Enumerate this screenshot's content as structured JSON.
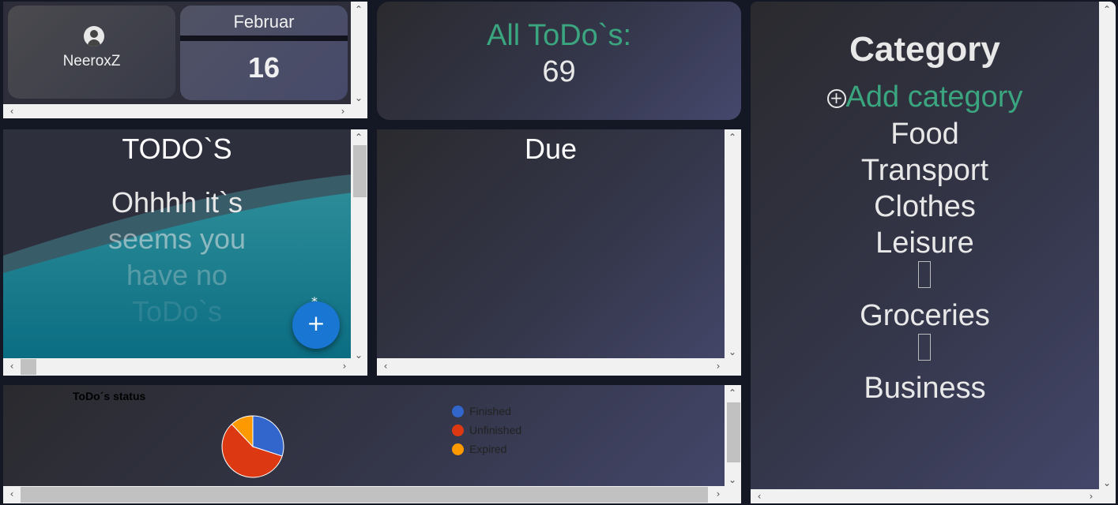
{
  "profile": {
    "username": "NeeroxZ",
    "icon": "user-circle-icon"
  },
  "calendar": {
    "month": "Februar",
    "day": "16"
  },
  "summary": {
    "label": "All ToDo`s:",
    "count": "69"
  },
  "todos": {
    "title": "TODO`S",
    "empty_line1": "Ohhhh it`s",
    "empty_line2": "seems you",
    "empty_line3": "have no",
    "empty_line4": "ToDo`s",
    "add_icon": "plus-icon"
  },
  "due": {
    "title": "Due"
  },
  "status": {
    "title": "ToDo´s status",
    "legend": [
      {
        "label": "Finished",
        "color": "#3366cc"
      },
      {
        "label": "Unfinished",
        "color": "#dc3912"
      },
      {
        "label": "Expired",
        "color": "#ff9900"
      }
    ]
  },
  "chart_data": {
    "type": "pie",
    "title": "ToDo´s status",
    "categories": [
      "Finished",
      "Unfinished",
      "Expired"
    ],
    "values": [
      30,
      58,
      12
    ],
    "colors": [
      "#3366cc",
      "#dc3912",
      "#ff9900"
    ],
    "legend_position": "right"
  },
  "category": {
    "title": "Category",
    "add_label": "Add category",
    "add_icon": "plus-circle-icon",
    "items": [
      "Food",
      "Transport",
      "Clothes",
      "Leisure",
      "Groceries",
      "Business"
    ]
  },
  "colors": {
    "accent": "#3aa57e",
    "panel_dark": "#2a2a2e",
    "panel_light": "#45486c",
    "fab": "#1976d2"
  }
}
